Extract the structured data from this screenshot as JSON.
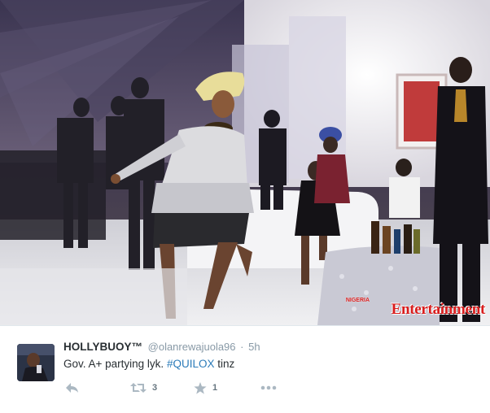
{
  "photo": {
    "description_icon": "party-photo",
    "watermark_brand": "Entertainment",
    "watermark_prefix": "NIGERIA"
  },
  "tweet": {
    "display_name": "HOLLYBUOY™",
    "handle": "@olanrewajuola96",
    "separator": "·",
    "time": "5h",
    "text_prefix": "Gov. A+ partying lyk. ",
    "hashtag": "#QUILOX",
    "text_suffix": " tinz",
    "actions": {
      "reply_icon": "reply-icon",
      "retweet_icon": "retweet-icon",
      "retweet_count": "3",
      "favorite_icon": "star-icon",
      "favorite_count": "1",
      "more_icon": "more-icon"
    }
  },
  "colors": {
    "link": "#2b7bb9",
    "text": "#292f33",
    "muted": "#8899a6",
    "icon": "#abb8c2",
    "watermark": "#d81c1c"
  }
}
